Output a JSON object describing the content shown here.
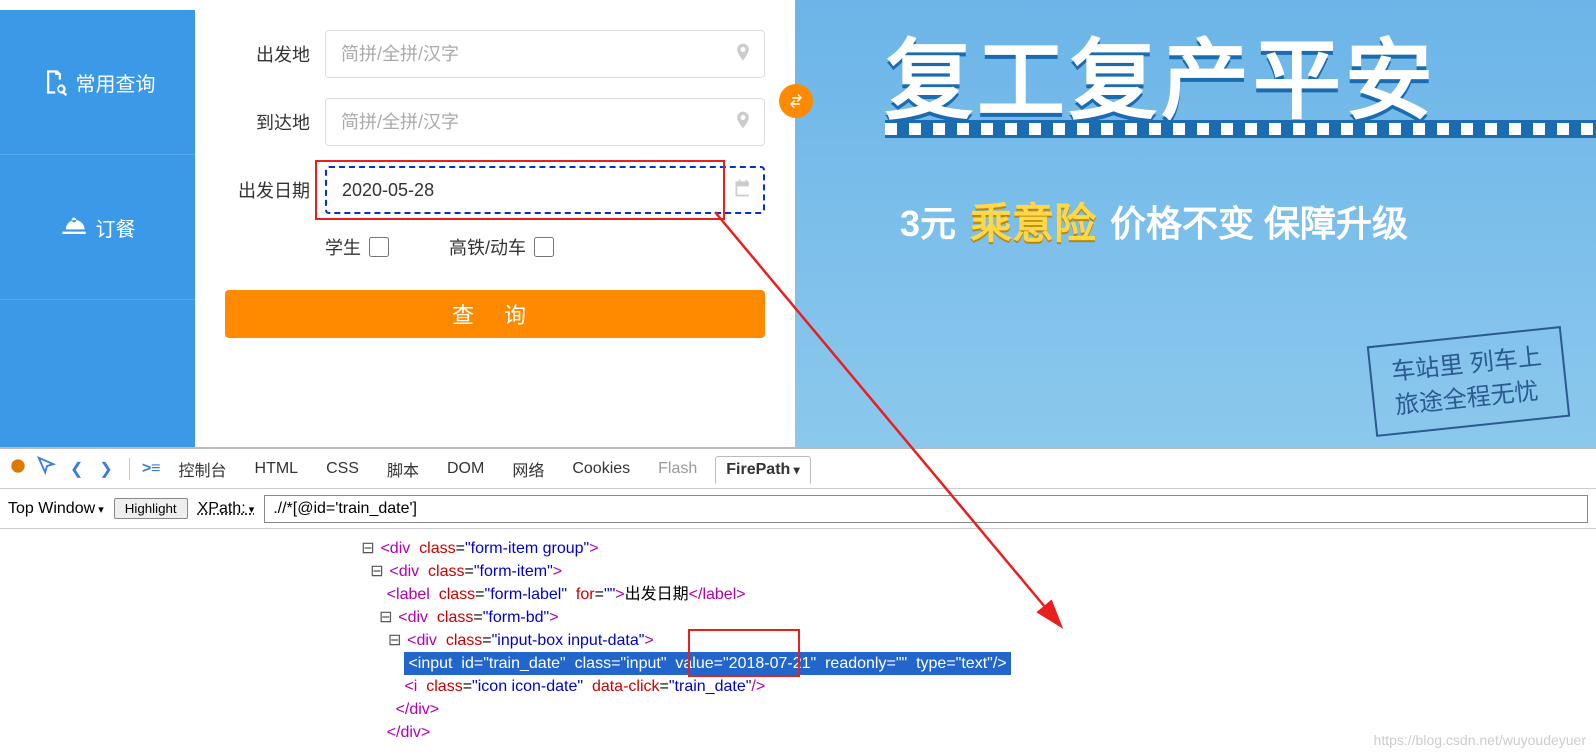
{
  "sidebar": {
    "items": [
      {
        "label": "常用查询"
      },
      {
        "label": "订餐"
      }
    ]
  },
  "form": {
    "from_label": "出发地",
    "from_placeholder": "简拼/全拼/汉字",
    "to_label": "到达地",
    "to_placeholder": "简拼/全拼/汉字",
    "date_label": "出发日期",
    "date_value": "2020-05-28",
    "student_label": "学生",
    "gaotie_label": "高铁/动车",
    "query_btn": "查 询"
  },
  "banner": {
    "title": "复工复产平安",
    "sub_price": "3元",
    "sub_name": "乘意险",
    "sub_rest": "价格不变  保障升级",
    "card_line1": "车站里 列车上",
    "card_line2": "旅途全程无忧"
  },
  "devtools": {
    "tabs": {
      "console": "控制台",
      "html": "HTML",
      "css": "CSS",
      "script": "脚本",
      "dom": "DOM",
      "net": "网络",
      "cookies": "Cookies",
      "flash": "Flash",
      "firepath": "FirePath"
    },
    "toolbar": {
      "topwin": "Top Window",
      "highlight": "Highlight",
      "xpath_label": "XPath:",
      "xpath_value": ".//*[@id='train_date']"
    },
    "source": {
      "l1": {
        "tag": "div",
        "cls": "form-item group"
      },
      "l2": {
        "tag": "div",
        "cls": "form-item"
      },
      "l3": {
        "tag": "label",
        "cls": "form-label",
        "for": "",
        "text": "出发日期"
      },
      "l4": {
        "tag": "div",
        "cls": "form-bd"
      },
      "l5": {
        "tag": "div",
        "cls": "input-box input-data"
      },
      "l6": {
        "tag": "input",
        "id": "train_date",
        "cls": "input",
        "value": "2018-07-21",
        "readonly": "",
        "type": "text"
      },
      "l7": {
        "tag": "i",
        "cls": "icon icon-date",
        "dataclick": "train_date"
      },
      "l8": "</div>",
      "l9": "</div>"
    }
  },
  "watermark": "https://blog.csdn.net/wuyoudeyuer"
}
